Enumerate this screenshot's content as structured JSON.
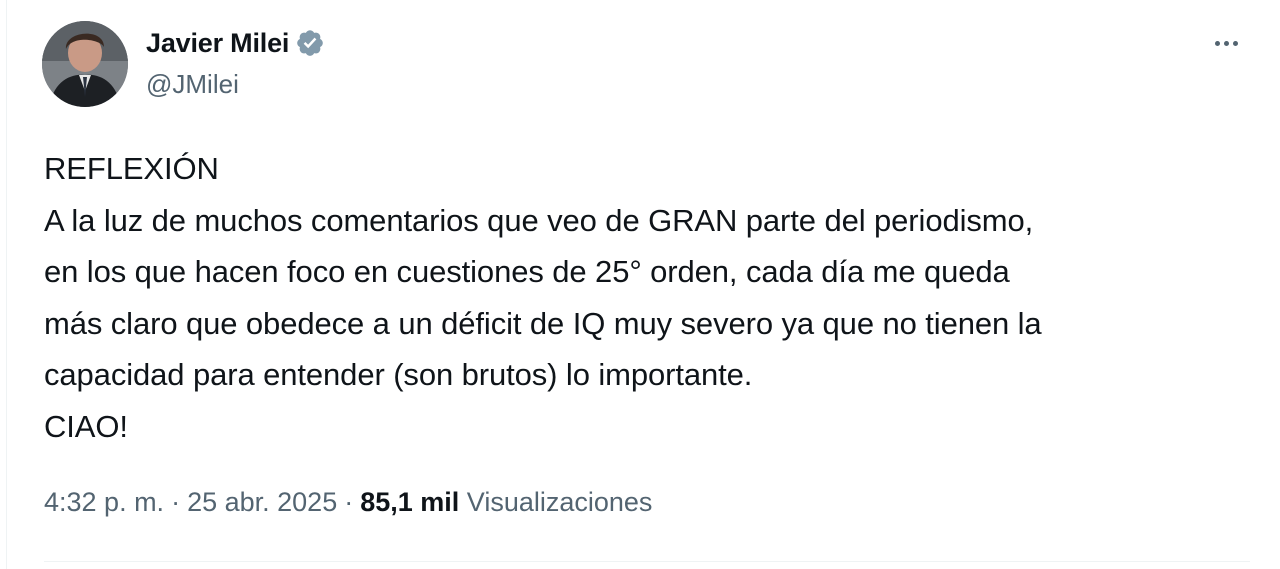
{
  "author": {
    "display_name": "Javier Milei",
    "handle": "@JMilei",
    "verified_icon": "verified-badge-icon",
    "verified_color": "#829aab"
  },
  "more_icon": "more-options-icon",
  "tweet": {
    "lines": [
      "REFLEXIÓN",
      "A la luz de muchos comentarios que veo de GRAN parte del periodismo,",
      "en los que hacen foco en cuestiones de 25° orden, cada día me queda",
      "más claro que obedece a un déficit de IQ muy severo ya que no tienen la",
      "capacidad para entender (son brutos) lo importante.",
      "CIAO!"
    ]
  },
  "meta": {
    "time": "4:32 p. m.",
    "separator": "·",
    "date": "25 abr. 2025",
    "views_count": "85,1 mil",
    "views_label": "Visualizaciones"
  },
  "colors": {
    "text": "#0f1419",
    "secondary": "#536471",
    "divider": "#eff3f4"
  }
}
